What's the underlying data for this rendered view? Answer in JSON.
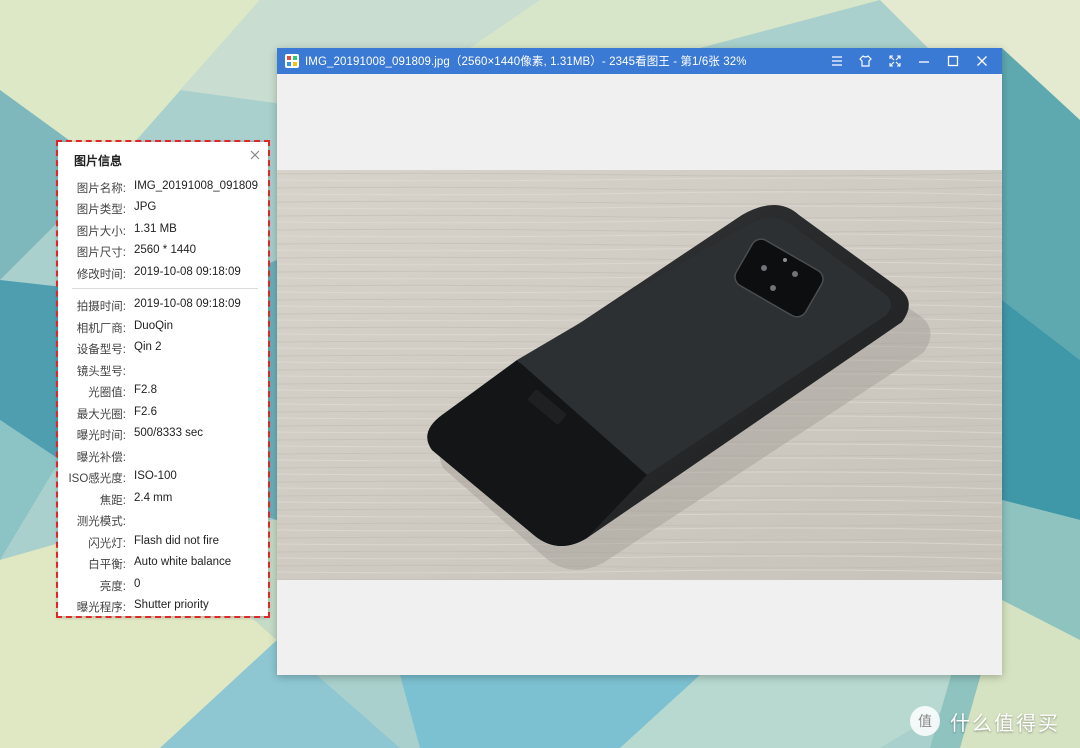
{
  "window": {
    "title": "IMG_20191008_091809.jpg（2560×1440像素, 1.31MB）- 2345看图王 - 第1/6张 32%",
    "controls": [
      "menu-icon",
      "skin-icon",
      "fullscreen-icon",
      "minimize-icon",
      "maximize-icon",
      "close-icon"
    ]
  },
  "info_panel": {
    "title": "图片信息",
    "rows": [
      {
        "key": "图片名称:",
        "value": "IMG_20191008_091809"
      },
      {
        "key": "图片类型:",
        "value": "JPG"
      },
      {
        "key": "图片大小:",
        "value": "1.31 MB"
      },
      {
        "key": "图片尺寸:",
        "value": "2560 * 1440"
      },
      {
        "key": "修改时间:",
        "value": "2019-10-08 09:18:09"
      },
      {
        "key": "拍摄时间:",
        "value": "2019-10-08 09:18:09"
      },
      {
        "key": "相机厂商:",
        "value": "DuoQin"
      },
      {
        "key": "设备型号:",
        "value": "Qin 2"
      },
      {
        "key": "镜头型号:",
        "value": ""
      },
      {
        "key": "光圈值:",
        "value": "F2.8"
      },
      {
        "key": "最大光圈:",
        "value": "F2.6"
      },
      {
        "key": "曝光时间:",
        "value": "500/8333 sec"
      },
      {
        "key": "曝光补偿:",
        "value": ""
      },
      {
        "key": "ISO感光度:",
        "value": "ISO-100"
      },
      {
        "key": "焦距:",
        "value": "2.4 mm"
      },
      {
        "key": "测光模式:",
        "value": ""
      },
      {
        "key": "闪光灯:",
        "value": "Flash did not fire"
      },
      {
        "key": "白平衡:",
        "value": "Auto white balance"
      },
      {
        "key": "亮度:",
        "value": "0"
      },
      {
        "key": "曝光程序:",
        "value": "Shutter priority"
      }
    ]
  },
  "watermark": {
    "badge": "值",
    "text": "什么值得买"
  },
  "colors": {
    "titlebar": "#3a79d4",
    "highlight_frame": "#e0252b"
  }
}
